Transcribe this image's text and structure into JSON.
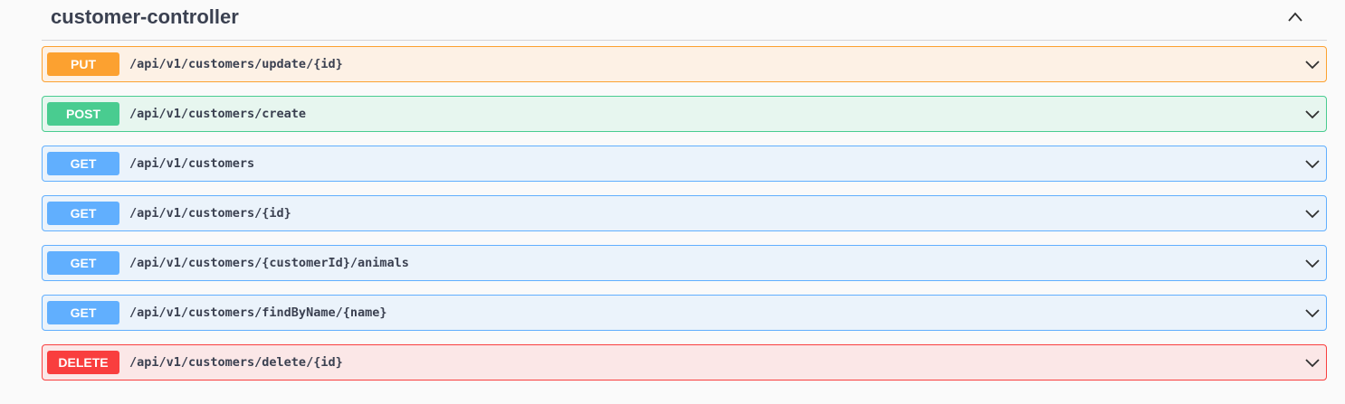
{
  "section": {
    "title": "customer-controller",
    "expanded": true
  },
  "method_colors": {
    "PUT": {
      "badge": "#fca130",
      "bg": "#fdf1e5",
      "border": "#fca130"
    },
    "POST": {
      "badge": "#49cc90",
      "bg": "#e7f6ef",
      "border": "#49cc90"
    },
    "GET": {
      "badge": "#61affe",
      "bg": "#ebf3fb",
      "border": "#61affe"
    },
    "DELETE": {
      "badge": "#f93e3e",
      "bg": "#fbe7e7",
      "border": "#f93e3e"
    }
  },
  "operations": [
    {
      "method": "PUT",
      "path": "/api/v1/customers/update/{id}"
    },
    {
      "method": "POST",
      "path": "/api/v1/customers/create"
    },
    {
      "method": "GET",
      "path": "/api/v1/customers"
    },
    {
      "method": "GET",
      "path": "/api/v1/customers/{id}"
    },
    {
      "method": "GET",
      "path": "/api/v1/customers/{customerId}/animals"
    },
    {
      "method": "GET",
      "path": "/api/v1/customers/findByName/{name}"
    },
    {
      "method": "DELETE",
      "path": "/api/v1/customers/delete/{id}"
    }
  ]
}
